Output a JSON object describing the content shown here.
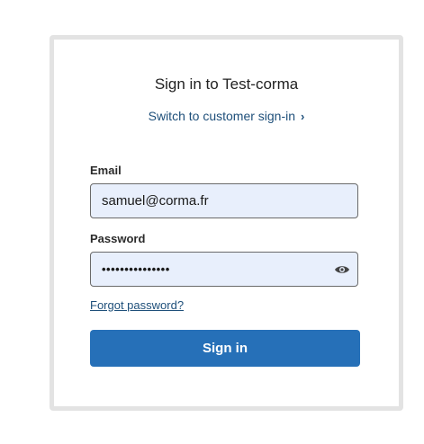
{
  "signin": {
    "title": "Sign in to Test-corma",
    "switch_link": "Switch to customer sign-in",
    "email_label": "Email",
    "email_value": "samuel@corma.fr",
    "password_label": "Password",
    "password_value": "•••••••••••••••",
    "forgot_link": "Forgot password?",
    "submit_label": "Sign in"
  },
  "icons": {
    "switch_chevron": "chevron-right-icon",
    "password_toggle": "eye-icon"
  },
  "colors": {
    "accent": "#2670b8",
    "link": "#1e4f7a",
    "field_bg": "#e8effc",
    "card_border": "#e3e3e3"
  }
}
